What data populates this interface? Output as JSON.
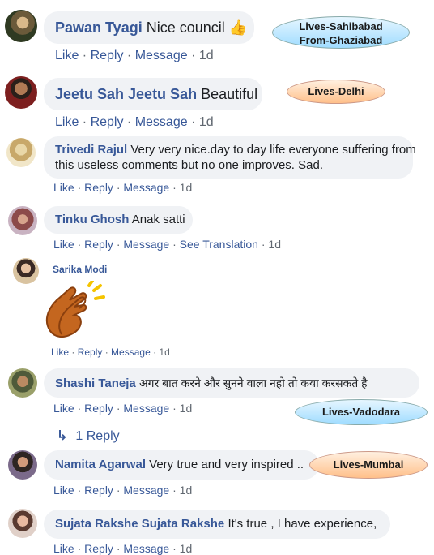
{
  "comments": [
    {
      "name": "Pawan Tyagi",
      "text": "Nice council",
      "emoji": "👍",
      "actions": [
        "Like",
        "Reply",
        "Message"
      ],
      "time": "1d"
    },
    {
      "name": "Jeetu Sah Jeetu Sah",
      "text": "Beautiful",
      "actions": [
        "Like",
        "Reply",
        "Message"
      ],
      "time": "1d"
    },
    {
      "name": "Trivedi Rajul",
      "text": "Very very nice.day to day life everyone suffering from",
      "text2": "this useless comments but no one improves. Sad.",
      "actions": [
        "Like",
        "Reply",
        "Message"
      ],
      "time": "1d"
    },
    {
      "name": "Tinku Ghosh",
      "text": "Anak satti",
      "actions": [
        "Like",
        "Reply",
        "Message",
        "See Translation"
      ],
      "time": "1d"
    },
    {
      "name": "Sarika Modi",
      "emoji": "👏",
      "actions": [
        "Like",
        "Reply",
        "Message"
      ],
      "time": "1d"
    },
    {
      "name": "Shashi Taneja",
      "text": "अगर बात करने और सुनने वाला नहो तो कया करसकते है",
      "actions": [
        "Like",
        "Reply",
        "Message"
      ],
      "time": "1d"
    },
    {
      "name": "Namita Agarwal",
      "text": "Very true and very inspired ..",
      "actions": [
        "Like",
        "Reply",
        "Message"
      ],
      "time": "1d"
    },
    {
      "name": "Sujata Rakshe Sujata Rakshe",
      "text": "It's true , I have experience,",
      "actions": [
        "Like",
        "Reply",
        "Message"
      ],
      "time": "1d"
    }
  ],
  "replies_link": {
    "icon": "reply-arrow-icon",
    "arrow": "↳",
    "label": "1 Reply"
  },
  "annotations": [
    {
      "line1": "Lives-Sahibabad",
      "line2": "From-Ghaziabad"
    },
    {
      "line1": "Lives-Delhi"
    },
    {
      "line1": "Lives-Vadodara"
    },
    {
      "line1": "Lives-Mumbai"
    }
  ],
  "colors": {
    "link": "#385898",
    "bubble": "#f0f2f5",
    "meta": "#606770",
    "tag_blue": "#9fdcff",
    "tag_orange": "#ffc08a"
  }
}
